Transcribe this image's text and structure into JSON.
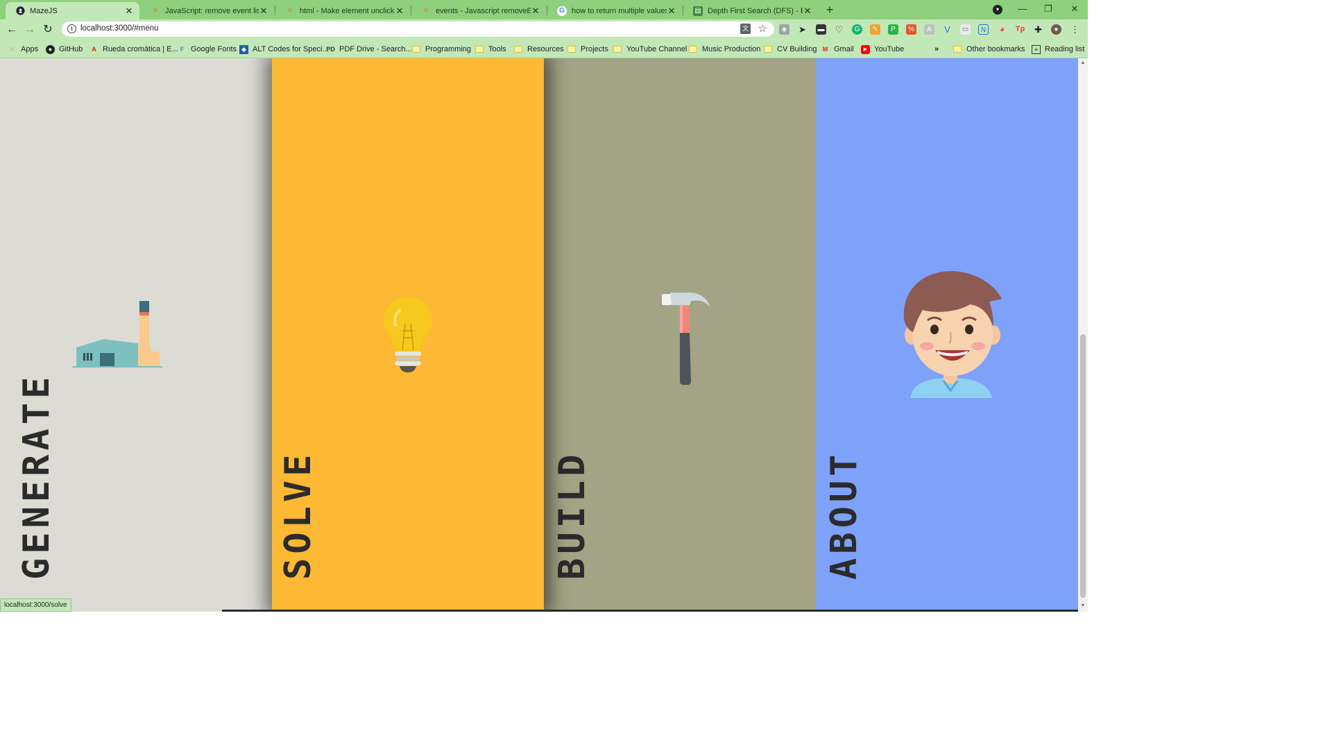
{
  "tabs": [
    {
      "title": "MazeJS",
      "active": true
    },
    {
      "title": "JavaScript: remove event listener"
    },
    {
      "title": "html - Make element unclickable"
    },
    {
      "title": "events - Javascript removeEventL"
    },
    {
      "title": "how to return multiple values in"
    },
    {
      "title": "Depth First Search (DFS) - Backtr"
    }
  ],
  "toolbar": {
    "url": "localhost:3000/#menu"
  },
  "bookmarks": [
    {
      "label": "Apps"
    },
    {
      "label": "GitHub"
    },
    {
      "label": "Rueda cromática | E..."
    },
    {
      "label": "Google Fonts"
    },
    {
      "label": "ALT Codes for Speci..."
    },
    {
      "label": "PDF Drive - Search..."
    },
    {
      "label": "Programming"
    },
    {
      "label": "Tools"
    },
    {
      "label": "Resources"
    },
    {
      "label": "Projects"
    },
    {
      "label": "YouTube Channel"
    },
    {
      "label": "Music Production"
    },
    {
      "label": "CV Building"
    },
    {
      "label": "Gmail"
    },
    {
      "label": "YouTube"
    }
  ],
  "bookmarks_extra": {
    "other": "Other bookmarks",
    "reading": "Reading list"
  },
  "menu": {
    "panels": [
      {
        "label": "GENERATE",
        "color": "#dcdbd4",
        "icon": "factory-icon"
      },
      {
        "label": "SOLVE",
        "color": "#fdb933",
        "icon": "lightbulb-icon"
      },
      {
        "label": "BUILD",
        "color": "#a3a386",
        "icon": "hammer-icon"
      },
      {
        "label": "ABOUT",
        "color": "#7ea2f9",
        "icon": "person-avatar-icon"
      }
    ]
  },
  "status": {
    "hover_url": "localhost:3000/solve"
  },
  "colors": {
    "frame": "#8fd07f",
    "toolbar": "#c3e8b8"
  }
}
